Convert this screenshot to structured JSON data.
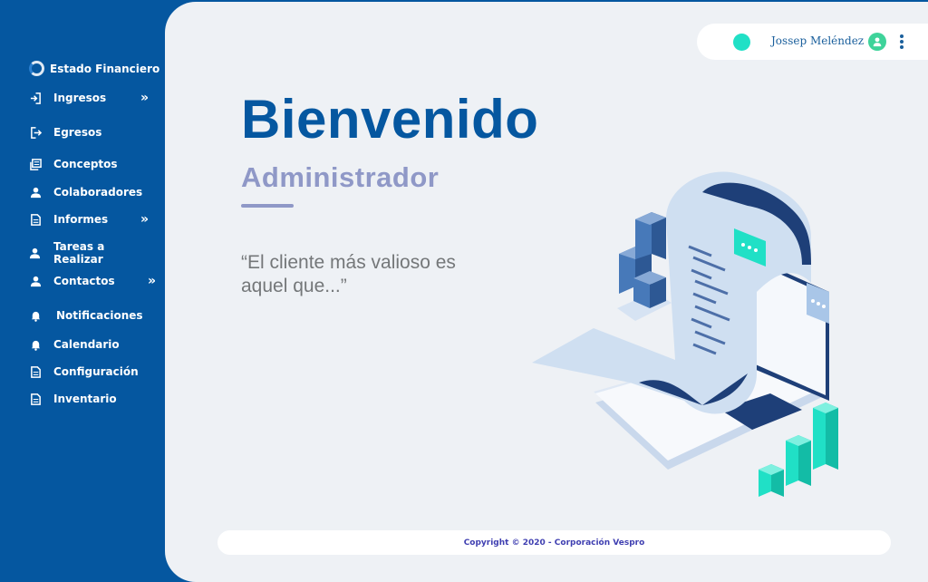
{
  "sidebar": {
    "brand": "Estado Financiero",
    "items": [
      {
        "label": "Ingresos",
        "icon": "sign-in-icon",
        "has_children": true
      },
      {
        "label": "Egresos",
        "icon": "sign-out-icon",
        "has_children": false
      },
      {
        "label": "Conceptos",
        "icon": "list-icon",
        "has_children": false
      },
      {
        "label": "Colaboradores",
        "icon": "user-icon",
        "has_children": false
      },
      {
        "label": "Informes",
        "icon": "document-icon",
        "has_children": true
      },
      {
        "label": "Tareas a Realizar",
        "icon": "user-icon",
        "has_children": false
      },
      {
        "label": "Contactos",
        "icon": "user-icon",
        "has_children": true
      },
      {
        "label": "Notificaciones",
        "icon": "bell-icon",
        "has_children": false
      },
      {
        "label": "Calendario",
        "icon": "bell-icon",
        "has_children": false
      },
      {
        "label": "Configuración",
        "icon": "document-icon",
        "has_children": false
      },
      {
        "label": "Inventario",
        "icon": "document-icon",
        "has_children": false
      }
    ],
    "chevron": "»"
  },
  "header": {
    "user_name": "Jossep Meléndez",
    "status_color": "#20e0c6",
    "avatar_color": "#3ed39a"
  },
  "main": {
    "title": "Bienvenido",
    "subtitle": "Administrador",
    "quote": "“El cliente más valioso es aquel que...”"
  },
  "footer": {
    "text": "Copyright © 2020 - Corporación Vespro"
  },
  "colors": {
    "primary": "#0557a0",
    "accent": "#8f98c7",
    "teal": "#20e0c6",
    "background": "#eef1f5"
  }
}
